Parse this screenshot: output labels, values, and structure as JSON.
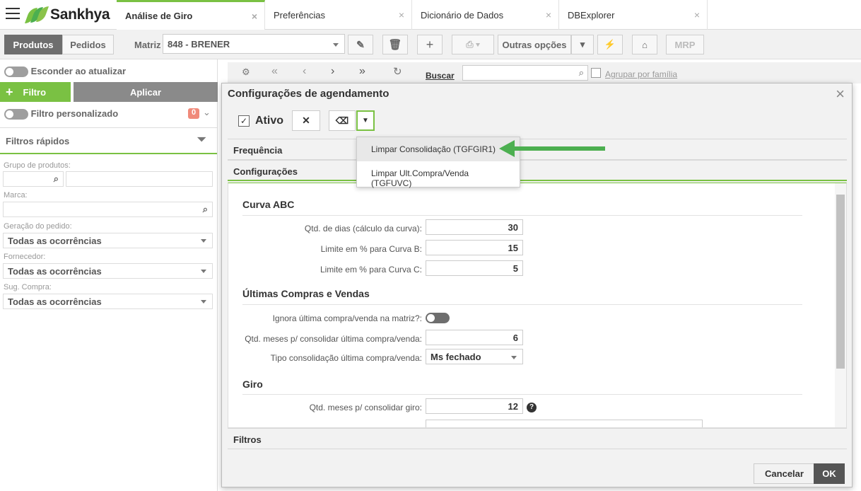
{
  "app": {
    "brand": "Sankhya"
  },
  "tabs": [
    {
      "label": "Análise de Giro",
      "active": true
    },
    {
      "label": "Preferências"
    },
    {
      "label": "Dicionário de Dados"
    },
    {
      "label": "DBExplorer"
    }
  ],
  "toolbar": {
    "produtos": "Produtos",
    "pedidos": "Pedidos",
    "matriz_label": "Matriz",
    "matriz_value": "848 - BRENER",
    "outras_opcoes": "Outras opções",
    "mrp": "MRP"
  },
  "sidebar": {
    "esconder": "Esconder ao atualizar",
    "filtro": "Filtro",
    "aplicar": "Aplicar",
    "filtro_personalizado": "Filtro personalizado",
    "filtro_count": "0",
    "filtros_rapidos": "Filtros rápidos",
    "grupo_label": "Grupo de produtos:",
    "marca_label": "Marca:",
    "geracao_label": "Geração do pedido:",
    "geracao_value": "Todas as ocorrências",
    "fornecedor_label": "Fornecedor:",
    "fornecedor_value": "Todas as ocorrências",
    "sug_label": "Sug. Compra:",
    "sug_value": "Todas as ocorrências"
  },
  "background": {
    "buscar": "Buscar",
    "agrupar": "Agrupar por família"
  },
  "modal": {
    "title": "Configurações de agendamento",
    "ativo": "Ativo",
    "frequencia": "Frequência",
    "configuracoes": "Configurações",
    "filtros": "Filtros",
    "cancelar": "Cancelar",
    "ok": "OK",
    "curva_title": "Curva ABC",
    "qtd_dias_label": "Qtd. de dias (cálculo da curva):",
    "qtd_dias_value": "30",
    "limite_b_label": "Limite em % para Curva B:",
    "limite_b_value": "15",
    "limite_c_label": "Limite em % para Curva C:",
    "limite_c_value": "5",
    "ultimas_title": "Últimas Compras e Vendas",
    "ignora_label": "Ignora última compra/venda na matriz?:",
    "qtd_meses_label": "Qtd. meses p/ consolidar última compra/venda:",
    "qtd_meses_value": "6",
    "tipo_label": "Tipo consolidação última compra/venda:",
    "tipo_value": "Ms fechado",
    "giro_title": "Giro",
    "qtd_giro_label": "Qtd. meses p/ consolidar giro:",
    "qtd_giro_value": "12"
  },
  "dropdown": {
    "items": [
      "Limpar Consolidação (TGFGIR1)",
      "Limpar Ult.Compra/Venda (TGFUVC)"
    ]
  },
  "colors": {
    "accent": "#7ac143",
    "arrow": "#4caf50"
  }
}
